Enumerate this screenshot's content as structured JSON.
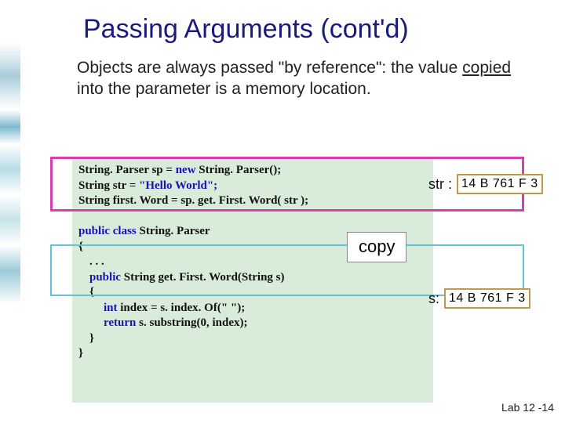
{
  "title": "Passing Arguments (cont'd)",
  "body": {
    "pre": "Objects are always passed \"by reference\": the value ",
    "underlined": "copied",
    "post": " into the parameter is a memory location."
  },
  "code1": {
    "l1a": "String. Parser sp = ",
    "l1b": "new",
    "l1c": " String. Parser();",
    "l2a": "String str = ",
    "l2b": "\"Hello World\";",
    "l3": "String first. Word = sp. get. First. Word( str );"
  },
  "code2": {
    "l1a": "public class",
    "l1b": " String. Parser",
    "l2": "{",
    "l3": ". . .",
    "l4a": "public",
    "l4b": " String get. First. Word(String s)",
    "l5": "{",
    "l6a": "int",
    "l6b": " index = s. index. Of(\" \");",
    "l7a": "return",
    "l7b": " s. substring(0, index);",
    "l8": "}",
    "l9": "}"
  },
  "copy_label": "copy",
  "mem1": {
    "label": "str :",
    "value": "14 B 761 F 3"
  },
  "mem2": {
    "label": "s:",
    "value": "14 B 761 F 3"
  },
  "footer": "Lab 12 -14"
}
